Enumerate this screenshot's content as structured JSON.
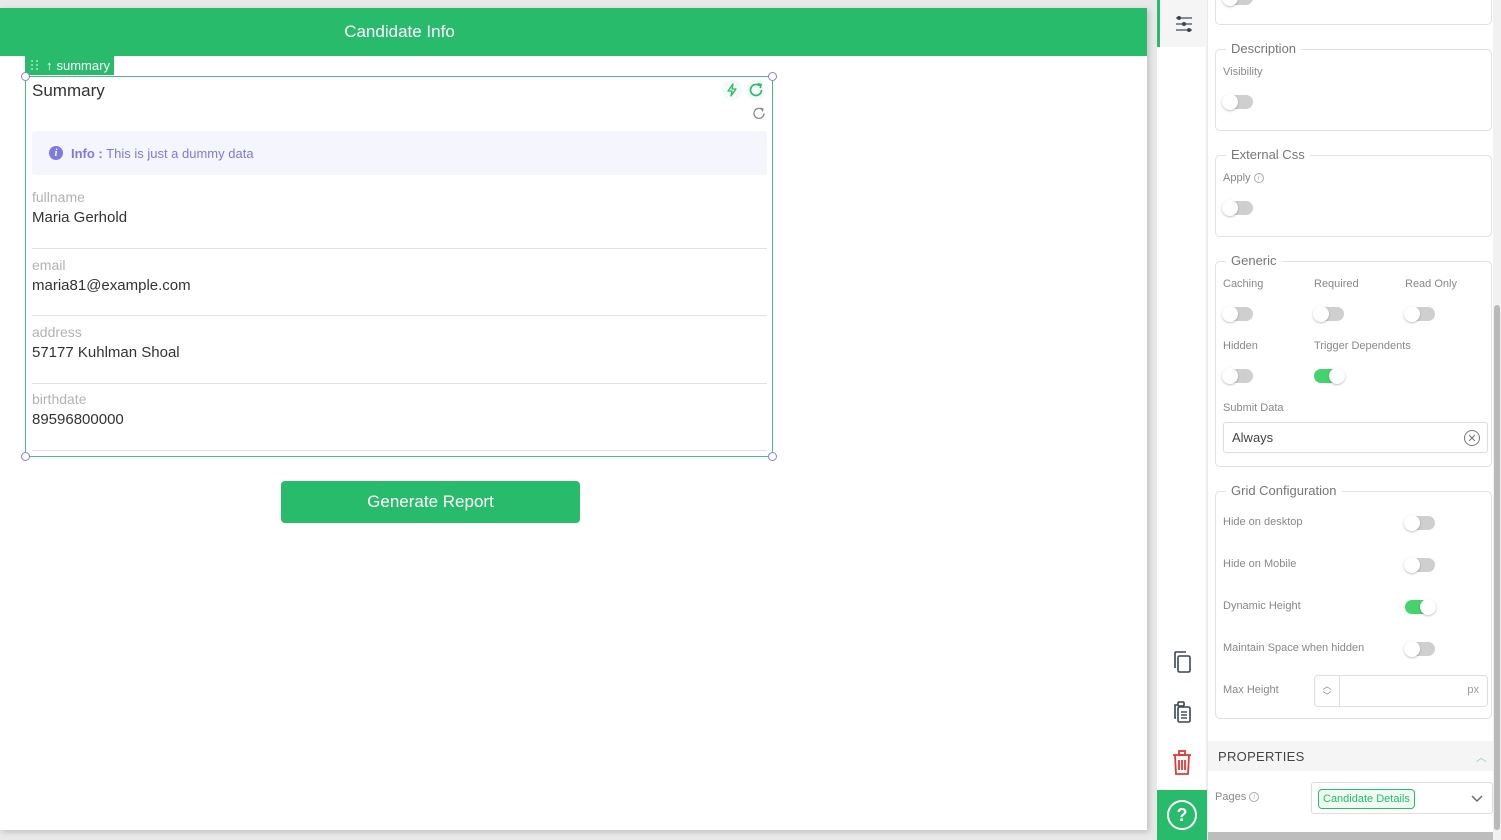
{
  "canvas": {
    "header_title": "Candidate Info",
    "widget_tag": "summary",
    "summary": {
      "title": "Summary",
      "info_label": "Info :",
      "info_text": "This is just a dummy data",
      "fields": [
        {
          "label": "fullname",
          "value": "Maria Gerhold"
        },
        {
          "label": "email",
          "value": "maria81@example.com"
        },
        {
          "label": "address",
          "value": "57177 Kuhlman Shoal"
        },
        {
          "label": "birthdate",
          "value": "89596800000"
        }
      ]
    },
    "generate_button": "Generate Report"
  },
  "toolbar": {
    "icons": [
      "settings-sliders-icon",
      "copy-icon",
      "paste-icon",
      "delete-icon",
      "help-icon"
    ],
    "help_label": "?"
  },
  "panel": {
    "description": {
      "legend": "Description",
      "visibility_label": "Visibility",
      "visibility": false
    },
    "external_css": {
      "legend": "External Css",
      "apply_label": "Apply",
      "apply": false
    },
    "generic": {
      "legend": "Generic",
      "caching_label": "Caching",
      "caching": false,
      "required_label": "Required",
      "required": false,
      "read_only_label": "Read Only",
      "read_only": false,
      "hidden_label": "Hidden",
      "hidden": false,
      "trigger_dependents_label": "Trigger Dependents",
      "trigger_dependents": true,
      "submit_data_label": "Submit Data",
      "submit_data_value": "Always"
    },
    "grid": {
      "legend": "Grid Configuration",
      "hide_desktop_label": "Hide on desktop",
      "hide_desktop": false,
      "hide_mobile_label": "Hide on Mobile",
      "hide_mobile": false,
      "dynamic_height_label": "Dynamic Height",
      "dynamic_height": true,
      "maintain_space_label": "Maintain Space when hidden",
      "maintain_space": false,
      "max_height_label": "Max Height",
      "max_height_value": "",
      "max_height_unit": "px"
    },
    "properties": {
      "header": "PROPERTIES",
      "pages_label": "Pages",
      "pages_selected": "Candidate Details"
    }
  },
  "colors": {
    "brand": "#28bb6b",
    "toggle_on": "#45d36b",
    "info": "#7e7ae0",
    "danger": "#e53935"
  }
}
